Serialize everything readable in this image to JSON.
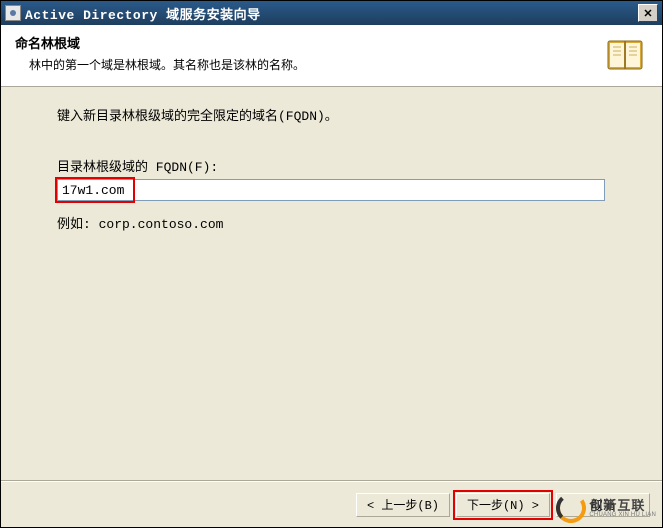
{
  "titlebar": {
    "title": "Active Directory 域服务安装向导"
  },
  "header": {
    "title": "命名林根域",
    "subtitle": "林中的第一个域是林根域。其名称也是该林的名称。"
  },
  "content": {
    "instruction": "键入新目录林根级域的完全限定的域名(FQDN)。",
    "field_label": "目录林根级域的 FQDN(F):",
    "fqdn_value": "17w1.com",
    "example": "例如: corp.contoso.com"
  },
  "footer": {
    "back": "< 上一步(B)",
    "next": "下一步(N) >",
    "cancel": "取消"
  },
  "watermark": {
    "zh": "创新互联",
    "en": "CHUANG XIN HU LIAN"
  }
}
